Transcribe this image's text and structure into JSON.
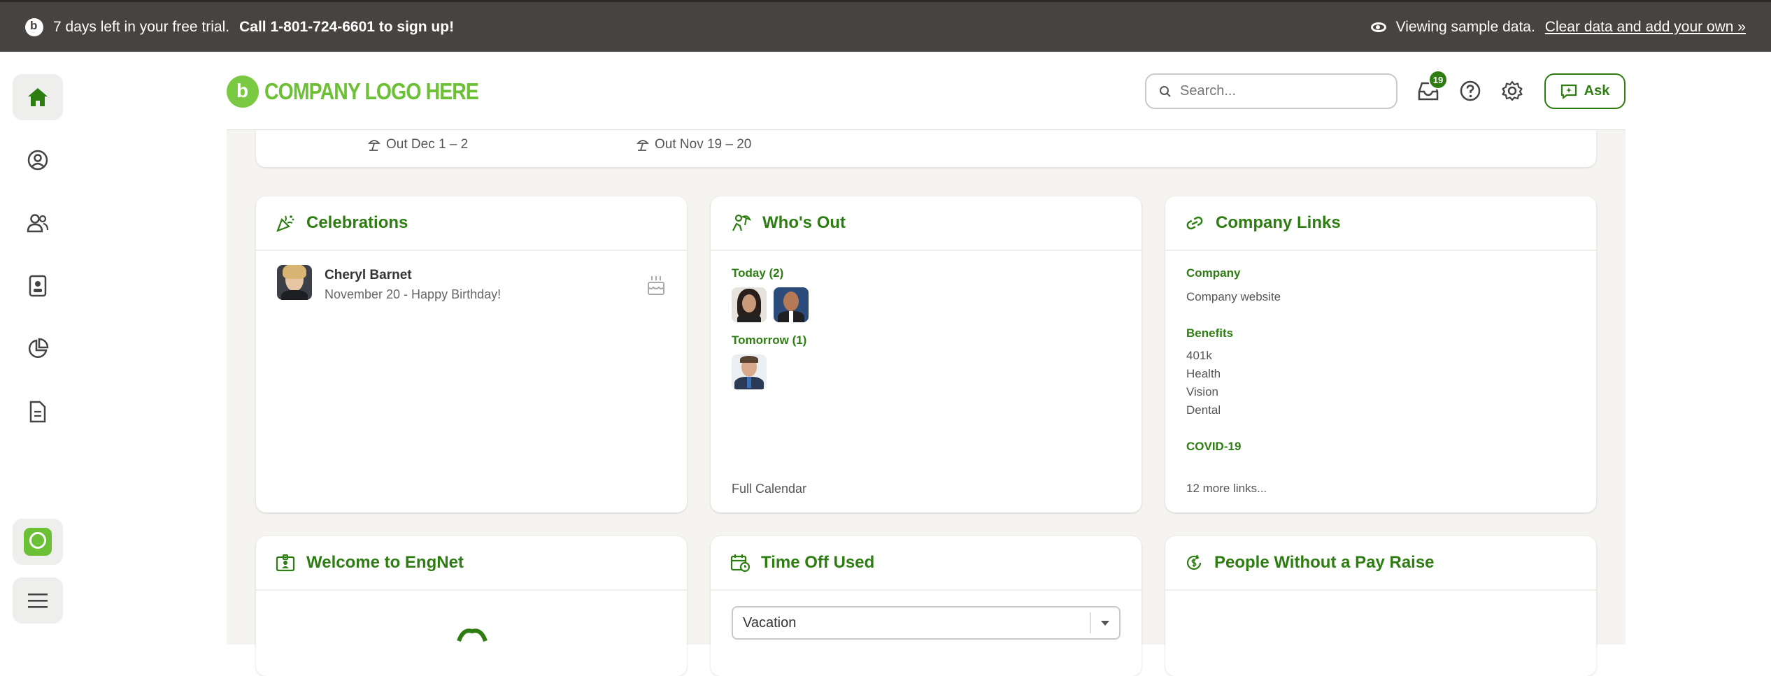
{
  "trial_banner": {
    "text": "7 days left in your free trial.",
    "cta": "Call 1-801-724-6601 to sign up!",
    "viewing_text": "Viewing sample data.",
    "clear_link": "Clear data and add your own »"
  },
  "header": {
    "logo_text": "COMPANY LOGO HERE",
    "search_placeholder": "Search...",
    "inbox_count": "19",
    "ask_label": "Ask"
  },
  "previous_card": {
    "out_1": "Out Dec 1 – 2",
    "out_2": "Out Nov 19 – 20"
  },
  "celebrations": {
    "title": "Celebrations",
    "name": "Cheryl Barnet",
    "detail": "November 20 - Happy Birthday!"
  },
  "whos_out": {
    "title": "Who's Out",
    "today": "Today (2)",
    "tomorrow": "Tomorrow (1)",
    "full_calendar": "Full Calendar"
  },
  "company_links": {
    "title": "Company Links",
    "groups": [
      {
        "label": "Company",
        "links": [
          "Company website"
        ]
      },
      {
        "label": "Benefits",
        "links": [
          "401k",
          "Health",
          "Vision",
          "Dental"
        ]
      },
      {
        "label": "COVID-19",
        "links": []
      }
    ],
    "more": "12 more links..."
  },
  "welcome": {
    "title": "Welcome to EngNet"
  },
  "time_off_used": {
    "title": "Time Off Used",
    "selected": "Vacation"
  },
  "no_raise": {
    "title": "People Without a Pay Raise"
  },
  "colors": {
    "brand_green": "#2e7d12",
    "logo_green": "#7ac943",
    "banner_bg": "#474341"
  }
}
